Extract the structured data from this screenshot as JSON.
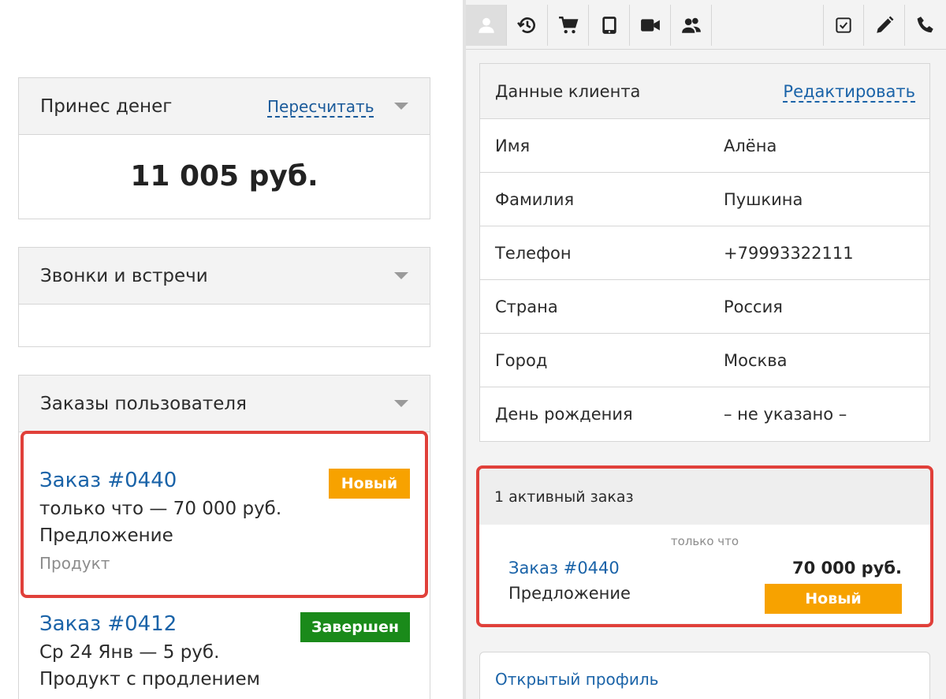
{
  "left": {
    "revenue": {
      "title": "Принес денег",
      "recalc_label": "Пересчитать",
      "amount": "11 005 руб."
    },
    "calls": {
      "title": "Звонки и встречи"
    },
    "orders": {
      "title": "Заказы пользователя",
      "items": [
        {
          "link": "Заказ #0440",
          "line1": "только что — 70 000 руб.",
          "line2": "Предложение",
          "line3": "Продукт",
          "badge": "Новый"
        },
        {
          "link": "Заказ #0412",
          "line1": "Ср 24 Янв — 5 руб.",
          "line2": "Продукт с продлением",
          "badge": "Завершен"
        }
      ]
    }
  },
  "right": {
    "tabs": [
      {
        "icon": "person-icon",
        "active": true
      },
      {
        "icon": "history-icon"
      },
      {
        "icon": "cart-icon"
      },
      {
        "icon": "tablet-icon"
      },
      {
        "icon": "video-icon"
      },
      {
        "icon": "group-icon"
      },
      {
        "icon": "checkbox-icon"
      },
      {
        "icon": "pencil-icon"
      },
      {
        "icon": "phone-icon"
      }
    ],
    "customer": {
      "title": "Данные клиента",
      "edit_label": "Редактировать",
      "rows": [
        {
          "key": "Имя",
          "value": "Алёна"
        },
        {
          "key": "Фамилия",
          "value": "Пушкина"
        },
        {
          "key": "Телефон",
          "value": "+79993322111"
        },
        {
          "key": "Страна",
          "value": "Россия"
        },
        {
          "key": "Город",
          "value": "Москва"
        },
        {
          "key": "День рождения",
          "value": "– не указано –"
        }
      ]
    },
    "active_orders": {
      "title": "1 активный заказ",
      "time": "только что",
      "link": "Заказ #0440",
      "desc": "Предложение",
      "sum": "70 000 руб.",
      "badge": "Новый"
    },
    "open_profile_label": "Открытый профиль"
  },
  "colors": {
    "link": "#1a63a8",
    "badge_new": "#f7a200",
    "badge_done": "#1a8a1a",
    "highlight": "#e0403a"
  }
}
